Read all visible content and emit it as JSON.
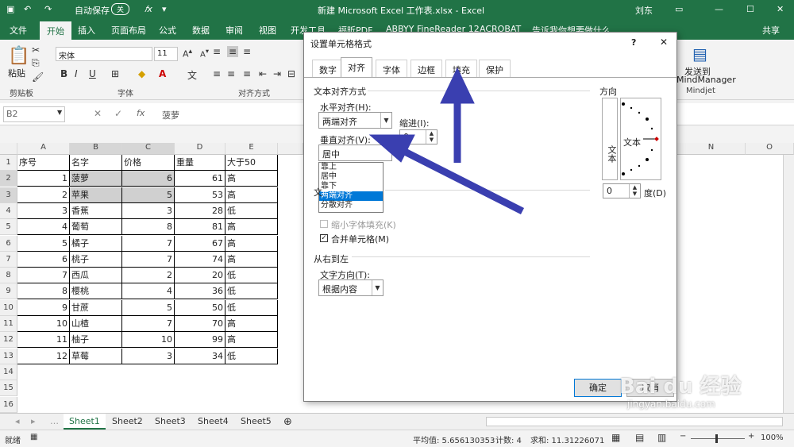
{
  "titlebar": {
    "autosave_label": "自动保存",
    "toggle_state": "关",
    "title": "新建 Microsoft Excel 工作表.xlsx - Excel",
    "user": "刘东"
  },
  "ribbon_tabs": [
    "文件",
    "开始",
    "插入",
    "页面布局",
    "公式",
    "数据",
    "审阅",
    "视图",
    "开发工具",
    "福昕PDF",
    "ABBYY FineReader 12",
    "ACROBAT",
    "告诉我你想要做什么"
  ],
  "share_label": "共享",
  "ribbon": {
    "paste_label": "粘贴",
    "clipboard_label": "剪贴板",
    "font_name": "宋体",
    "font_size": "11",
    "font_group_label": "字体",
    "align_group_label": "对齐方式",
    "bold": "B",
    "italic": "I",
    "underline": "U",
    "send_label_1": "发送到",
    "send_label_2": "MindManager",
    "mindjet_label": "Mindjet"
  },
  "formula_bar": {
    "name_box": "B2",
    "fx": "fx",
    "content": "菠萝"
  },
  "columns": [
    "A",
    "B",
    "C",
    "D",
    "E",
    "N",
    "O"
  ],
  "rows": [
    "1",
    "2",
    "3",
    "4",
    "5",
    "6",
    "7",
    "8",
    "9",
    "10",
    "11",
    "12",
    "13",
    "14",
    "15",
    "16"
  ],
  "table": {
    "header": [
      "序号",
      "名字",
      "价格",
      "重量",
      "大于50"
    ],
    "data": [
      [
        "1",
        "菠萝",
        "6",
        "61",
        "高"
      ],
      [
        "2",
        "苹果",
        "5",
        "53",
        "高"
      ],
      [
        "3",
        "香蕉",
        "3",
        "28",
        "低"
      ],
      [
        "4",
        "葡萄",
        "8",
        "81",
        "高"
      ],
      [
        "5",
        "橘子",
        "7",
        "67",
        "高"
      ],
      [
        "6",
        "桃子",
        "7",
        "74",
        "高"
      ],
      [
        "7",
        "西瓜",
        "2",
        "20",
        "低"
      ],
      [
        "8",
        "樱桃",
        "4",
        "36",
        "低"
      ],
      [
        "9",
        "甘蔗",
        "5",
        "50",
        "低"
      ],
      [
        "10",
        "山楂",
        "7",
        "70",
        "高"
      ],
      [
        "11",
        "柚子",
        "10",
        "99",
        "高"
      ],
      [
        "12",
        "草莓",
        "3",
        "34",
        "低"
      ]
    ]
  },
  "sheets": [
    "Sheet1",
    "Sheet2",
    "Sheet3",
    "Sheet4",
    "Sheet5"
  ],
  "status": {
    "ready": "就绪",
    "average": "平均值: 5.656130353",
    "count": "计数: 4",
    "sum": "求和: 11.31226071",
    "zoom": "100%"
  },
  "dialog": {
    "title": "设置单元格格式",
    "help": "?",
    "tabs": [
      "数字",
      "对齐",
      "字体",
      "边框",
      "填充",
      "保护"
    ],
    "text_alignment_label": "文本对齐方式",
    "horizontal_label": "水平对齐(H):",
    "horizontal_value": "两端对齐",
    "indent_label": "缩进(I):",
    "indent_value": "0",
    "vertical_label": "垂直对齐(V):",
    "vertical_value": "居中",
    "vertical_options": [
      "靠上",
      "居中",
      "靠下",
      "两端对齐",
      "分散对齐"
    ],
    "text_control_label": "文",
    "shrink_label": "缩小字体填充(K)",
    "merge_label": "合并单元格(M)",
    "rtl_label": "从右到左",
    "direction_label": "文字方向(T):",
    "direction_value": "根据内容",
    "orientation_label": "方向",
    "orientation_text_vertical": "文本",
    "orientation_text": "文本",
    "degree_value": "0",
    "degree_label": "度(D)",
    "ok_label": "确定",
    "cancel_label": "取消"
  },
  "watermark": {
    "brand": "Bai du 经验",
    "url": "jingyan.baidu.com"
  },
  "colors": {
    "excel_green": "#217346",
    "annotation_arrow": "#3a3fb0",
    "highlight": "#0078d7"
  }
}
